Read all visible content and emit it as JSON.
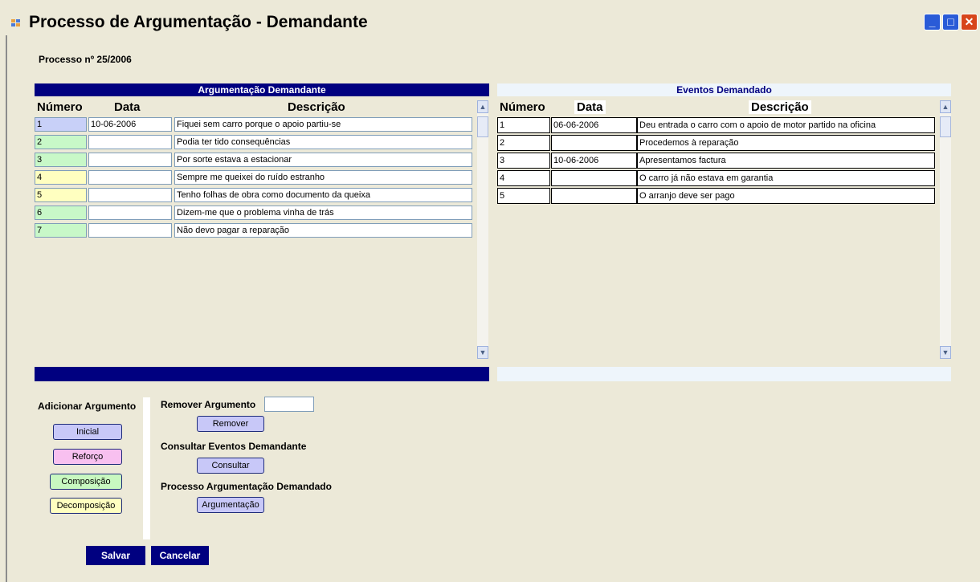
{
  "window": {
    "title": "Processo de Argumentação - Demandante",
    "controls": {
      "minimize": "_",
      "maximize": "□",
      "close": "✕"
    }
  },
  "process_label": "Processo nº 25/2006",
  "left_panel": {
    "header": "Argumentação Demandante",
    "columns": [
      "Número",
      "Data",
      "Descrição"
    ],
    "rows": [
      {
        "numero": "1",
        "data": "10-06-2006",
        "descricao": "Fiquei sem carro porque o apoio partiu-se",
        "color": "#c8d0f8"
      },
      {
        "numero": "2",
        "data": "",
        "descricao": "Podia ter tido consequências",
        "color": "#c8f8c8"
      },
      {
        "numero": "3",
        "data": "",
        "descricao": "Por sorte estava a estacionar",
        "color": "#c8f8c8"
      },
      {
        "numero": "4",
        "data": "",
        "descricao": "Sempre me queixei do ruído estranho",
        "color": "#ffffc0"
      },
      {
        "numero": "5",
        "data": "",
        "descricao": "Tenho folhas de obra como documento da queixa",
        "color": "#ffffc0"
      },
      {
        "numero": "6",
        "data": "",
        "descricao": "Dizem-me que o problema vinha de trás",
        "color": "#c8f8c8"
      },
      {
        "numero": "7",
        "data": "",
        "descricao": "Não devo pagar a reparação",
        "color": "#c8f8c8"
      }
    ]
  },
  "right_panel": {
    "header": "Eventos Demandado",
    "columns": [
      "Número",
      "Data",
      "Descrição"
    ],
    "rows": [
      {
        "numero": "1",
        "data": "06-06-2006",
        "descricao": "Deu entrada o carro com o apoio de motor partido na oficina"
      },
      {
        "numero": "2",
        "data": "",
        "descricao": "Procedemos à reparação"
      },
      {
        "numero": "3",
        "data": "10-06-2006",
        "descricao": "Apresentamos factura"
      },
      {
        "numero": "4",
        "data": "",
        "descricao": "O carro já não estava em garantia"
      },
      {
        "numero": "5",
        "data": "",
        "descricao": "O arranjo deve ser pago"
      }
    ]
  },
  "add_argument": {
    "label": "Adicionar Argumento",
    "buttons": [
      {
        "label": "Inicial",
        "color": "#c8c8f8"
      },
      {
        "label": "Reforço",
        "color": "#f8c0f0"
      },
      {
        "label": "Composição",
        "color": "#c8f8c0"
      },
      {
        "label": "Decomposição",
        "color": "#ffffc0"
      }
    ]
  },
  "remove_argument": {
    "label": "Remover Argumento",
    "button": "Remover",
    "input_value": ""
  },
  "consult_events": {
    "label": "Consultar Eventos Demandante",
    "button": "Consultar"
  },
  "argument_process": {
    "label": "Processo Argumentação Demandado",
    "button": "Argumentação"
  },
  "footer": {
    "save": "Salvar",
    "cancel": "Cancelar"
  },
  "colors": {
    "navy": "#000080",
    "light_header": "#eef5fb",
    "lavender_button": "#c8c8f8"
  }
}
